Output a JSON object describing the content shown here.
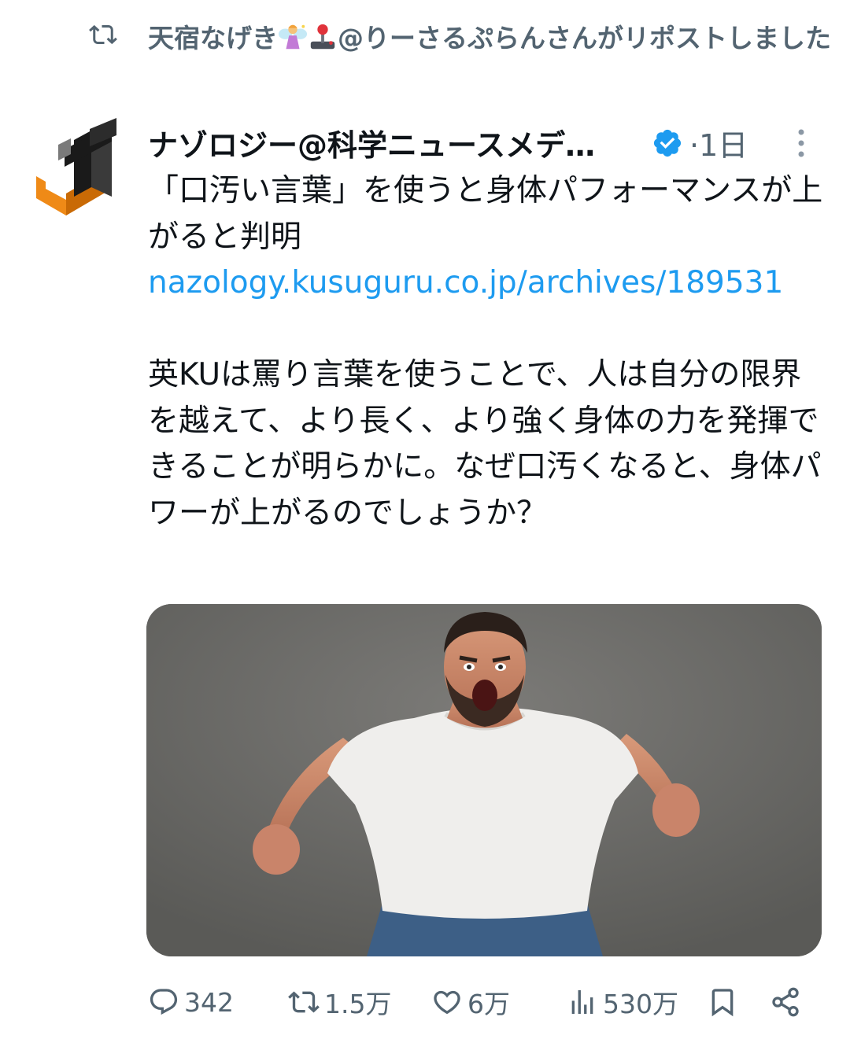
{
  "social_context": {
    "icon": "repost-icon",
    "text_before_emoji": "天宿なげき",
    "emojis": [
      "fairy-emoji",
      "joystick-emoji"
    ],
    "text_after_emoji": "@りーさるぷらんさんがリポストしました"
  },
  "post": {
    "author": {
      "display_name": "ナゾロジー@科学ニュースメデ…",
      "verified": true,
      "avatar_icon": "nazology-logo"
    },
    "timestamp": "·1日",
    "title": "「口汚い言葉」を使うと身体パフォーマンスが上がると判明",
    "link": "nazology.kusuguru.co.jp/archives/189531",
    "body": "英KUは罵り言葉を使うことで、人は自分の限界を越えて、より長く、より強く身体の力を発揮できることが明らかに。なぜ口汚くなると、身体パワーが上がるのでしょうか？",
    "media": {
      "description_icon": "photo-man-shouting"
    }
  },
  "actions": {
    "reply": "342",
    "repost": "1.5万",
    "like": "6万",
    "views": "530万"
  },
  "colors": {
    "accent": "#1d9bf0",
    "secondary_text": "#536471",
    "primary_text": "#0f1419",
    "logo_orange": "#ef8a17"
  }
}
